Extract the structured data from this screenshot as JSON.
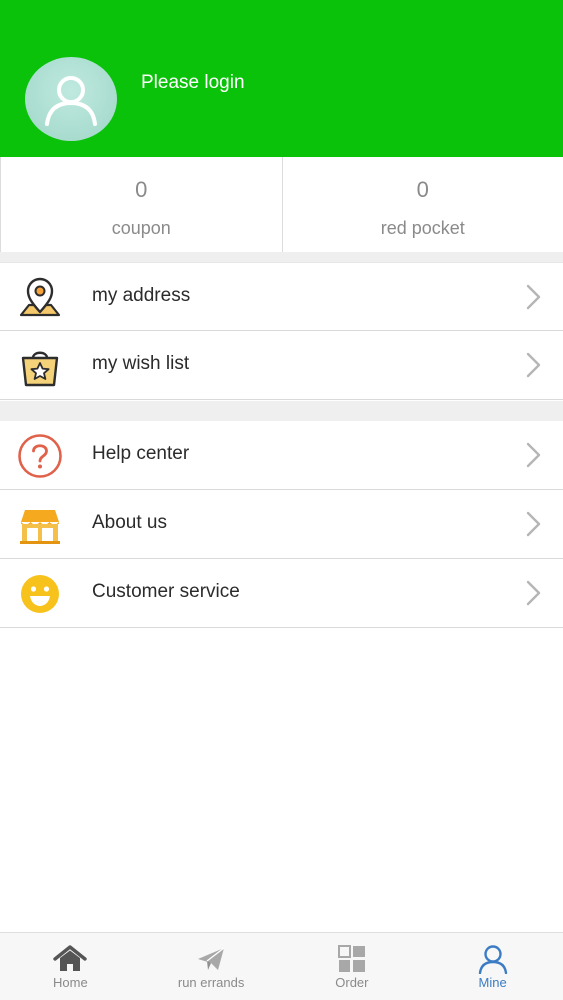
{
  "header": {
    "login_text": "Please login",
    "background_color": "#0bc20b"
  },
  "stats": [
    {
      "value": "0",
      "label": "coupon"
    },
    {
      "value": "0",
      "label": "red pocket"
    }
  ],
  "menu_group_1": [
    {
      "label": "my address",
      "icon": "map-pin-icon"
    },
    {
      "label": "my wish list",
      "icon": "shopping-bag-star-icon"
    }
  ],
  "menu_group_2": [
    {
      "label": "Help center",
      "icon": "question-circle-icon"
    },
    {
      "label": "About us",
      "icon": "storefront-icon"
    },
    {
      "label": "Customer service",
      "icon": "smiley-face-icon"
    }
  ],
  "tabbar": {
    "active_color": "#3b7cc4",
    "items": [
      {
        "label": "Home",
        "icon": "home-icon"
      },
      {
        "label": "run errands",
        "icon": "paper-plane-icon"
      },
      {
        "label": "Order",
        "icon": "grid-icon"
      },
      {
        "label": "Mine",
        "icon": "user-icon"
      }
    ]
  }
}
